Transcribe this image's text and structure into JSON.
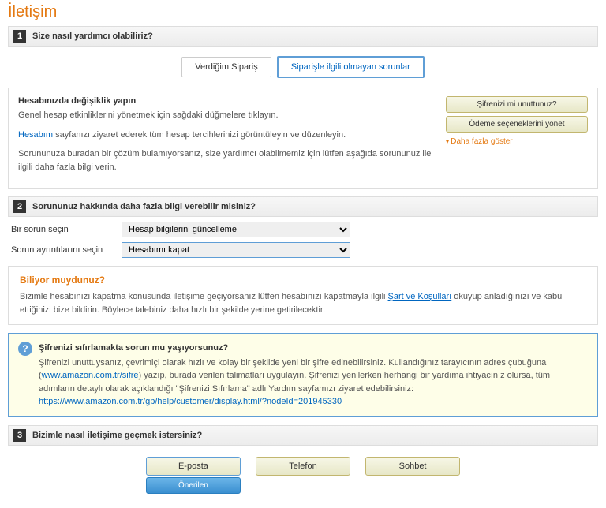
{
  "page_title": "İletişim",
  "step1": {
    "num": "1",
    "label": "Size nasıl yardımcı olabiliriz?",
    "tab1": "Verdiğim Sipariş",
    "tab2": "Siparişle ilgili olmayan sorunlar",
    "box_title": "Hesabınızda değişiklik yapın",
    "line1": "Genel hesap etkinliklerini yönetmek için sağdaki düğmelere tıklayın.",
    "account_link": "Hesabım",
    "line2": " sayfanızı ziyaret ederek tüm hesap tercihlerinizi görüntüleyin ve düzenleyin.",
    "line3": "Sorununuza buradan bir çözüm bulamıyorsanız, size yardımcı olabilmemiz için lütfen aşağıda sorununuz ile ilgili daha fazla bilgi verin.",
    "btn1": "Şifrenizi mi unuttunuz?",
    "btn2": "Ödeme seçeneklerini yönet",
    "more": "Daha fazla göster"
  },
  "step2": {
    "num": "2",
    "label": "Sorununuz hakkında daha fazla bilgi verebilir misiniz?",
    "row1_label": "Bir sorun seçin",
    "row1_value": "Hesap bilgilerini güncelleme",
    "row2_label": "Sorun ayrıntılarını seçin",
    "row2_value": "Hesabımı kapat"
  },
  "info": {
    "title": "Biliyor muydunuz?",
    "text1": "Bizimle hesabınızı kapatma konusunda iletişime geçiyorsanız lütfen hesabınızı kapatmayla ilgili ",
    "link": "Şart ve Koşulları",
    "text2": " okuyup anladığınızı ve kabul ettiğinizi bize bildirin. Böylece talebiniz daha hızlı bir şekilde yerine getirilecektir."
  },
  "alert": {
    "title": "Şifrenizi sıfırlamakta sorun mu yaşıyorsunuz?",
    "text1": "Şifrenizi unuttuysanız, çevrimiçi olarak hızlı ve kolay bir şekilde yeni bir şifre edinebilirsiniz. Kullandığınız tarayıcının adres çubuğuna (",
    "link1": "www.amazon.com.tr/sifre",
    "text2": ") yazıp, burada verilen talimatları uygulayın. Şifrenizi yenilerken herhangi bir yardıma ihtiyacınız olursa, tüm adımların detaylı olarak açıklandığı \"Şifrenizi Sıfırlama\" adlı Yardım sayfamızı ziyaret edebilirsiniz:",
    "link2": "https://www.amazon.com.tr/gp/help/customer/display.html/?nodeId=201945330"
  },
  "step3": {
    "num": "3",
    "label": "Bizimle nasıl iletişime geçmek istersiniz?",
    "opt1": "E-posta",
    "rec": "Önerilen",
    "opt2": "Telefon",
    "opt3": "Sohbet"
  }
}
